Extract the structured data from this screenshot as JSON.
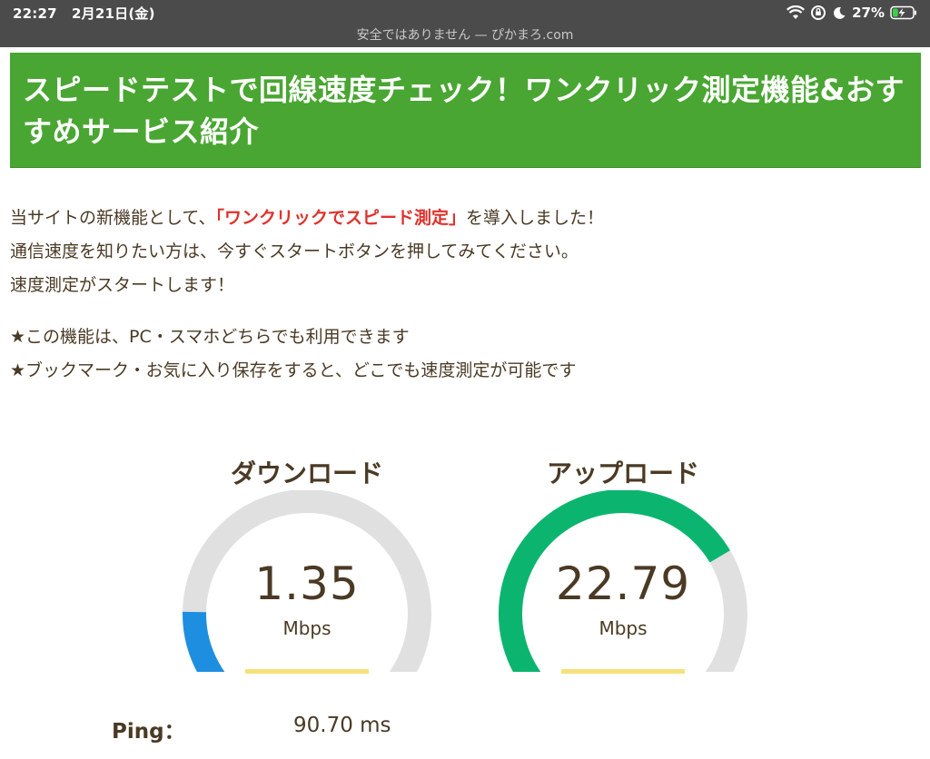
{
  "status_bar": {
    "time": "22:27",
    "date": "2月21日(金)",
    "battery_percent": "27%",
    "battery_level": 0.27,
    "url_text": "安全ではありません — ぴかまろ.com",
    "icons": [
      "wifi-icon",
      "orientation-lock-icon",
      "moon-icon",
      "battery-icon"
    ]
  },
  "page": {
    "title": "スピードテストで回線速度チェック！ワンクリック測定機能&おすすめサービス紹介",
    "intro_line1_before": "当サイトの新機能として、",
    "intro_line1_highlight": "「ワンクリックでスピード測定」",
    "intro_line1_after": "を導入しました！",
    "intro_line2": "通信速度を知りたい方は、今すぐスタートボタンを押してみてください。",
    "intro_line3": "速度測定がスタートします！",
    "note1": "★この機能は、PC・スマホどちらでも利用できます",
    "note2": "★ブックマーク・お気に入り保存をすると、どこでも速度測定が可能です"
  },
  "gauges": {
    "download": {
      "label": "ダウンロード",
      "value": "1.35",
      "unit": "Mbps",
      "fill_fraction": 0.17,
      "color": "#1e8fe0"
    },
    "upload": {
      "label": "アップロード",
      "value": "22.79",
      "unit": "Mbps",
      "fill_fraction": 0.72,
      "color": "#0bb56f"
    }
  },
  "ping": {
    "label": "Ping：",
    "value": "90.70 ms"
  },
  "colors": {
    "banner_green": "#49a632",
    "highlight_red": "#e0312c",
    "text_brown": "#4a3a24",
    "gauge_track": "#e0e0e0",
    "underline_yellow": "#f6e17a"
  }
}
